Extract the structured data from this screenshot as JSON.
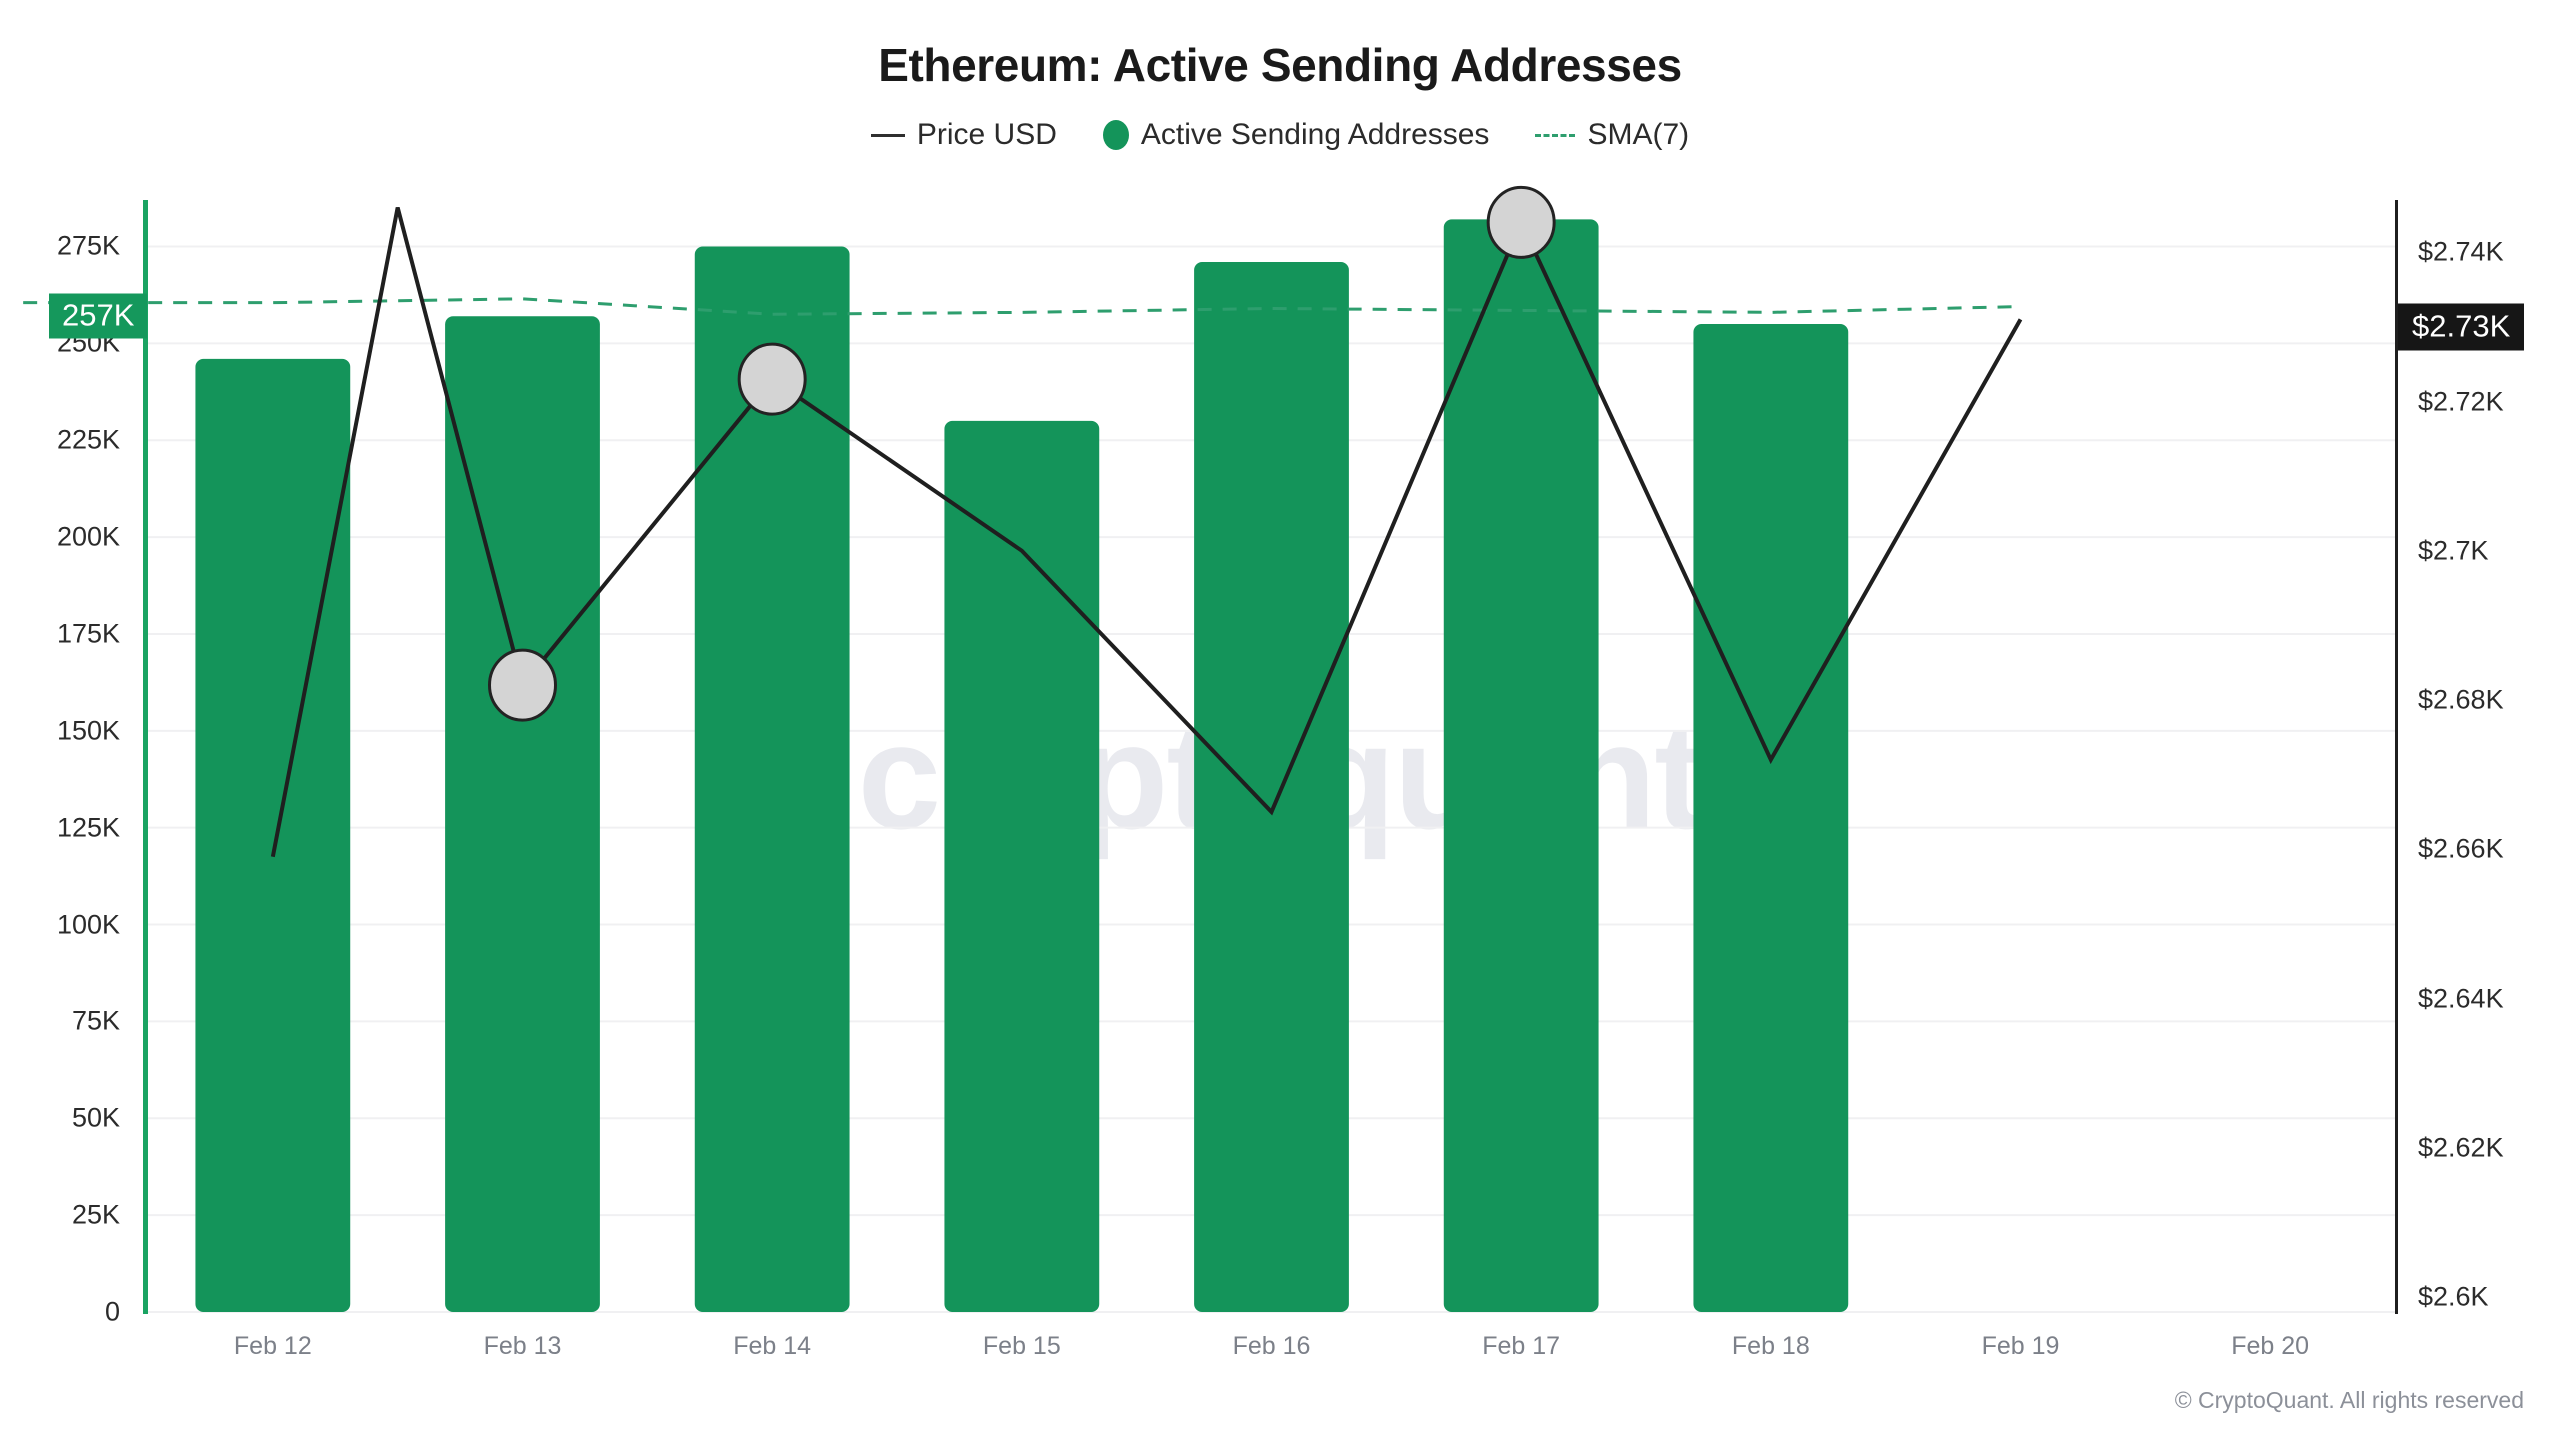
{
  "header": {
    "title": "Ethereum: Active Sending Addresses"
  },
  "legend": {
    "items": [
      {
        "label": "Price USD",
        "marker": "line-icon",
        "color": "#2f2f2f"
      },
      {
        "label": "Active Sending Addresses",
        "marker": "circle-icon",
        "color": "#14945a"
      },
      {
        "label": "SMA(7)",
        "marker": "dashed-line-icon",
        "color": "#2e9e6e"
      }
    ]
  },
  "footer": {
    "copyright": "© CryptoQuant. All rights reserved"
  },
  "watermark": {
    "text": "cryptoquant"
  },
  "highlights": {
    "left_badge": "257K",
    "left_badge_color": "#15985c",
    "right_badge": "$2.73K",
    "right_badge_color": "#161616"
  },
  "chart_data": {
    "type": "bar",
    "title": "Ethereum: Active Sending Addresses",
    "xlabel": "",
    "ylabel": "",
    "grid": true,
    "legend_position": "top-center",
    "categories": [
      "Feb 12",
      "Feb 13",
      "Feb 14",
      "Feb 15",
      "Feb 16",
      "Feb 17",
      "Feb 18",
      "Feb 19",
      "Feb 20"
    ],
    "left_axis": {
      "label": "Active Sending Addresses",
      "ticks": [
        "0",
        "25K",
        "50K",
        "75K",
        "100K",
        "125K",
        "150K",
        "175K",
        "200K",
        "225K",
        "250K",
        "275K"
      ],
      "tick_values": [
        0,
        25000,
        50000,
        75000,
        100000,
        125000,
        150000,
        175000,
        200000,
        225000,
        250000,
        275000
      ],
      "ylim": [
        0,
        287000
      ]
    },
    "right_axis": {
      "label": "Price USD",
      "ticks": [
        "$2.6K",
        "$2.62K",
        "$2.64K",
        "$2.66K",
        "$2.68K",
        "$2.7K",
        "$2.72K",
        "$2.73K",
        "$2.74K"
      ],
      "tick_values": [
        2600,
        2620,
        2640,
        2660,
        2680,
        2700,
        2720,
        2730,
        2740
      ],
      "ylim": [
        2598,
        2747
      ]
    },
    "series": [
      {
        "name": "Active Sending Addresses",
        "type": "bar",
        "color": "#14945a",
        "axis": "left",
        "x": [
          "Feb 12",
          "Feb 13",
          "Feb 14",
          "Feb 15",
          "Feb 16",
          "Feb 17",
          "Feb 18"
        ],
        "values": [
          246000,
          257000,
          275000,
          230000,
          271000,
          282000,
          255000
        ]
      },
      {
        "name": "SMA(7)",
        "type": "line",
        "style": "dashed",
        "color": "#2e9e6e",
        "axis": "left",
        "x": [
          "Feb 12",
          "Feb 13",
          "Feb 14",
          "Feb 15",
          "Feb 16",
          "Feb 17",
          "Feb 18",
          "Feb 19"
        ],
        "values": [
          260500,
          261500,
          257500,
          258000,
          259000,
          258500,
          258000,
          259500
        ]
      },
      {
        "name": "Price USD",
        "type": "line",
        "color": "#1f1f1f",
        "axis": "right",
        "x": [
          "Feb 12",
          "Feb 12.5",
          "Feb 13",
          "Feb 14",
          "Feb 15",
          "Feb 16",
          "Feb 17",
          "Feb 18",
          "Feb 19"
        ],
        "values": [
          2659,
          2746,
          2682,
          2723,
          2700,
          2665,
          2744,
          2672,
          2731
        ],
        "markers": [
          {
            "x": "Feb 13",
            "value": 2682
          },
          {
            "x": "Feb 14",
            "value": 2723
          },
          {
            "x": "Feb 17",
            "value": 2744
          }
        ]
      }
    ],
    "current_values": {
      "active_sending_addresses": "257K",
      "price_usd": "$2.73K"
    }
  }
}
